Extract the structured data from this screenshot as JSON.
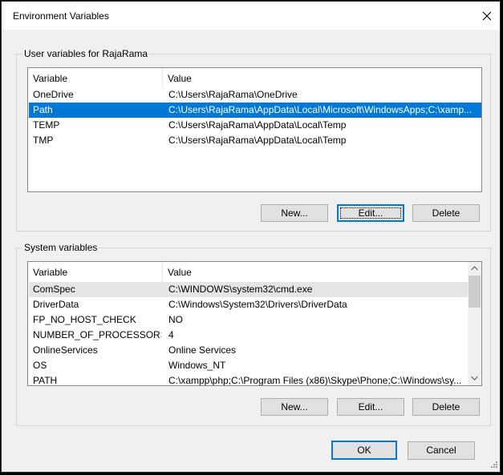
{
  "window": {
    "title": "Environment Variables"
  },
  "user_group": {
    "label": "User variables for RajaRama",
    "columns": [
      "Variable",
      "Value"
    ],
    "rows": [
      {
        "variable": "OneDrive",
        "value": "C:\\Users\\RajaRama\\OneDrive"
      },
      {
        "variable": "Path",
        "value": "C:\\Users\\RajaRama\\AppData\\Local\\Microsoft\\WindowsApps;C:\\xamp..."
      },
      {
        "variable": "TEMP",
        "value": "C:\\Users\\RajaRama\\AppData\\Local\\Temp"
      },
      {
        "variable": "TMP",
        "value": "C:\\Users\\RajaRama\\AppData\\Local\\Temp"
      }
    ],
    "buttons": {
      "new": "New...",
      "edit": "Edit...",
      "delete": "Delete"
    }
  },
  "system_group": {
    "label": "System variables",
    "columns": [
      "Variable",
      "Value"
    ],
    "rows": [
      {
        "variable": "ComSpec",
        "value": "C:\\WINDOWS\\system32\\cmd.exe"
      },
      {
        "variable": "DriverData",
        "value": "C:\\Windows\\System32\\Drivers\\DriverData"
      },
      {
        "variable": "FP_NO_HOST_CHECK",
        "value": "NO"
      },
      {
        "variable": "NUMBER_OF_PROCESSORS",
        "value": "4"
      },
      {
        "variable": "OnlineServices",
        "value": "Online Services"
      },
      {
        "variable": "OS",
        "value": "Windows_NT"
      },
      {
        "variable": "PATH",
        "value": "C:\\xampp\\php;C:\\Program Files (x86)\\Skype\\Phone;C:\\Windows\\sy..."
      }
    ],
    "buttons": {
      "new": "New...",
      "edit": "Edit...",
      "delete": "Delete"
    }
  },
  "footer": {
    "ok": "OK",
    "cancel": "Cancel"
  },
  "colors": {
    "selection": "#0078d7",
    "hover_row": "#e5e5e5",
    "window_bg": "#f0f0f0"
  }
}
